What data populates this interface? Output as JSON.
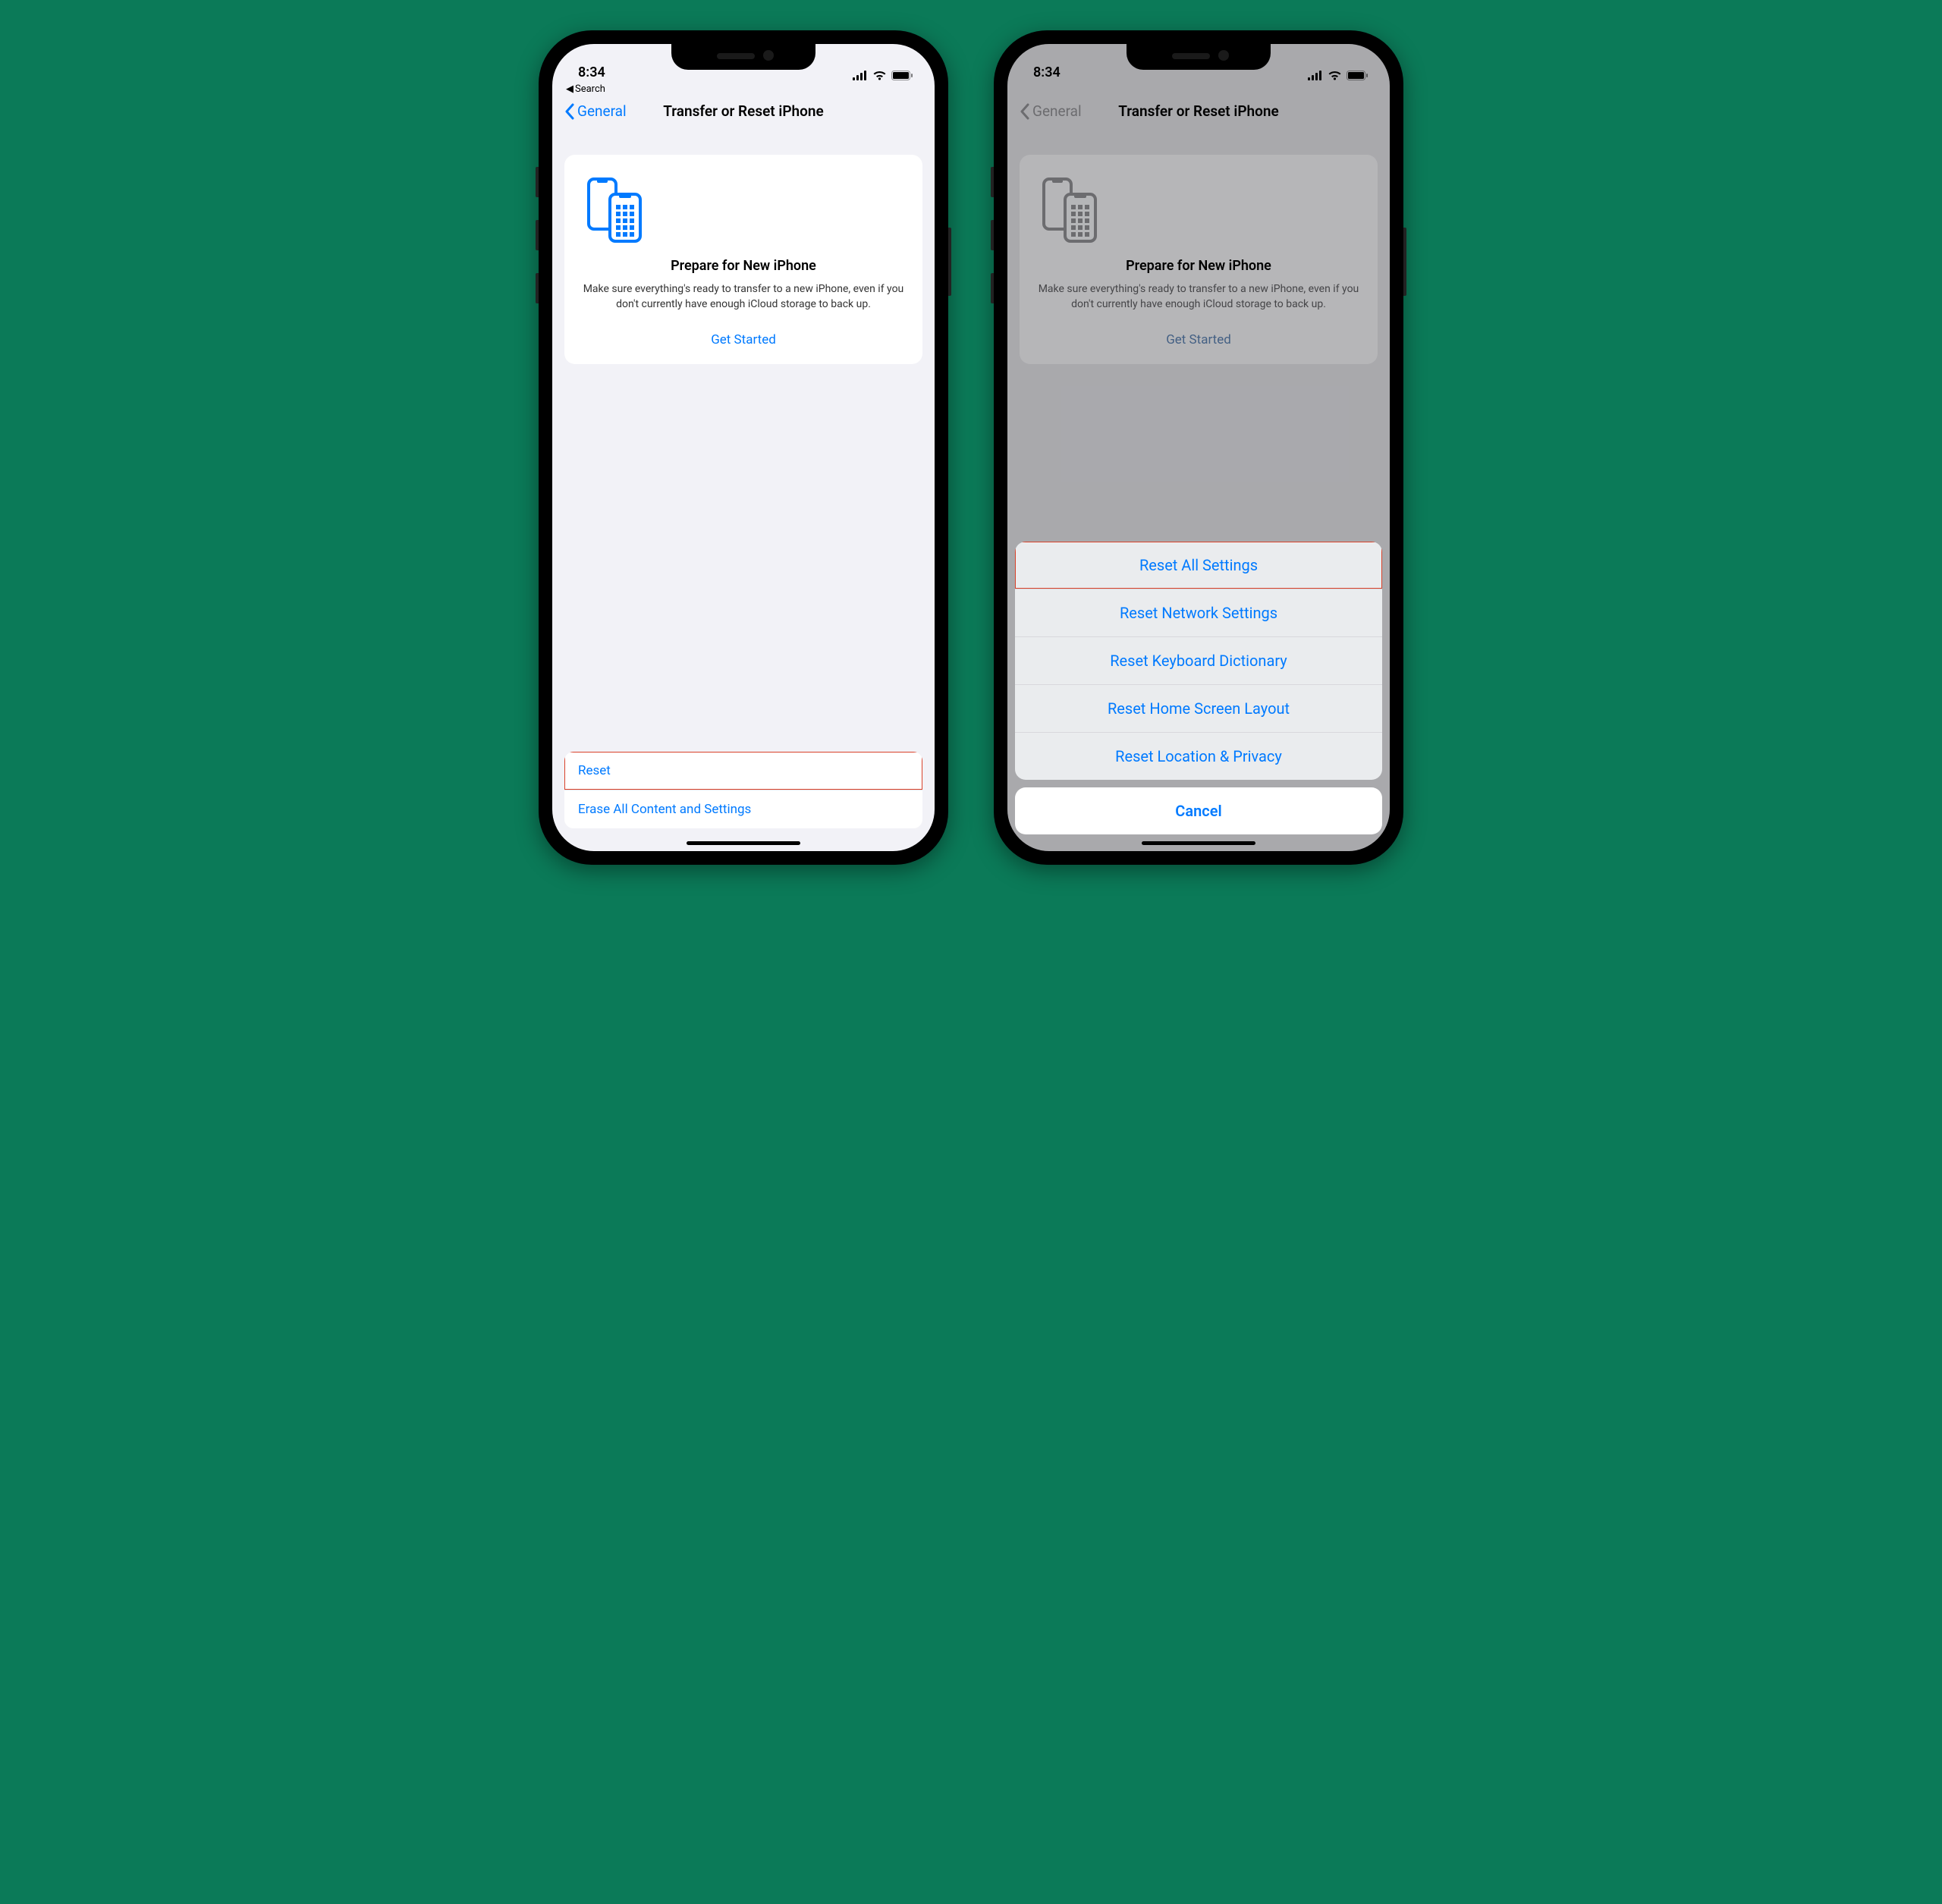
{
  "status": {
    "time": "8:34"
  },
  "back_search": {
    "label": "Search"
  },
  "nav": {
    "back_label": "General",
    "title": "Transfer or Reset iPhone"
  },
  "card": {
    "title": "Prepare for New iPhone",
    "desc": "Make sure everything's ready to transfer to a new iPhone, even if you don't currently have enough iCloud storage to back up.",
    "link": "Get Started"
  },
  "list": {
    "reset": "Reset",
    "erase": "Erase All Content and Settings"
  },
  "sheet": {
    "items": [
      "Reset All Settings",
      "Reset Network Settings",
      "Reset Keyboard Dictionary",
      "Reset Home Screen Layout",
      "Reset Location & Privacy"
    ],
    "cancel": "Cancel"
  }
}
